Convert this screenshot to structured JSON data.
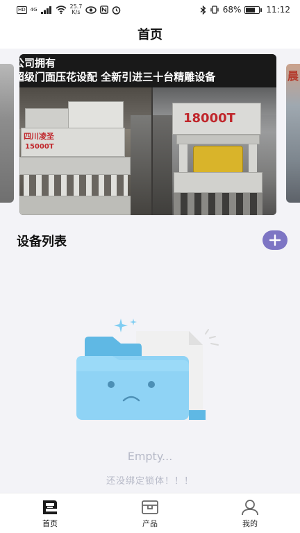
{
  "status_bar": {
    "network_badge": "HD",
    "signal_label": "4G",
    "speed_value": "25.7",
    "speed_unit": "K/s",
    "battery": "68%",
    "time": "11:12",
    "battery_level": 0.68
  },
  "header": {
    "title": "首页"
  },
  "banner": {
    "line1": "公司拥有",
    "line2": "超级门面压花设配  全新引进三十台精雕设备",
    "press_left_label": "15000T",
    "press_left_brand": "四川凌圣",
    "press_right_label": "18000T",
    "side_right_char": "晨"
  },
  "devices": {
    "section_title": "设备列表",
    "empty_title": "Empty...",
    "empty_message": "还没绑定锁体！！！"
  },
  "tabs": [
    {
      "label": "首页",
      "icon": "home-icon",
      "active": true
    },
    {
      "label": "产品",
      "icon": "product-icon",
      "active": false
    },
    {
      "label": "我的",
      "icon": "user-icon",
      "active": false
    }
  ],
  "colors": {
    "accent": "#7d75c4",
    "empty_text": "#b6b9c7",
    "folder": "#8fd3f5"
  }
}
